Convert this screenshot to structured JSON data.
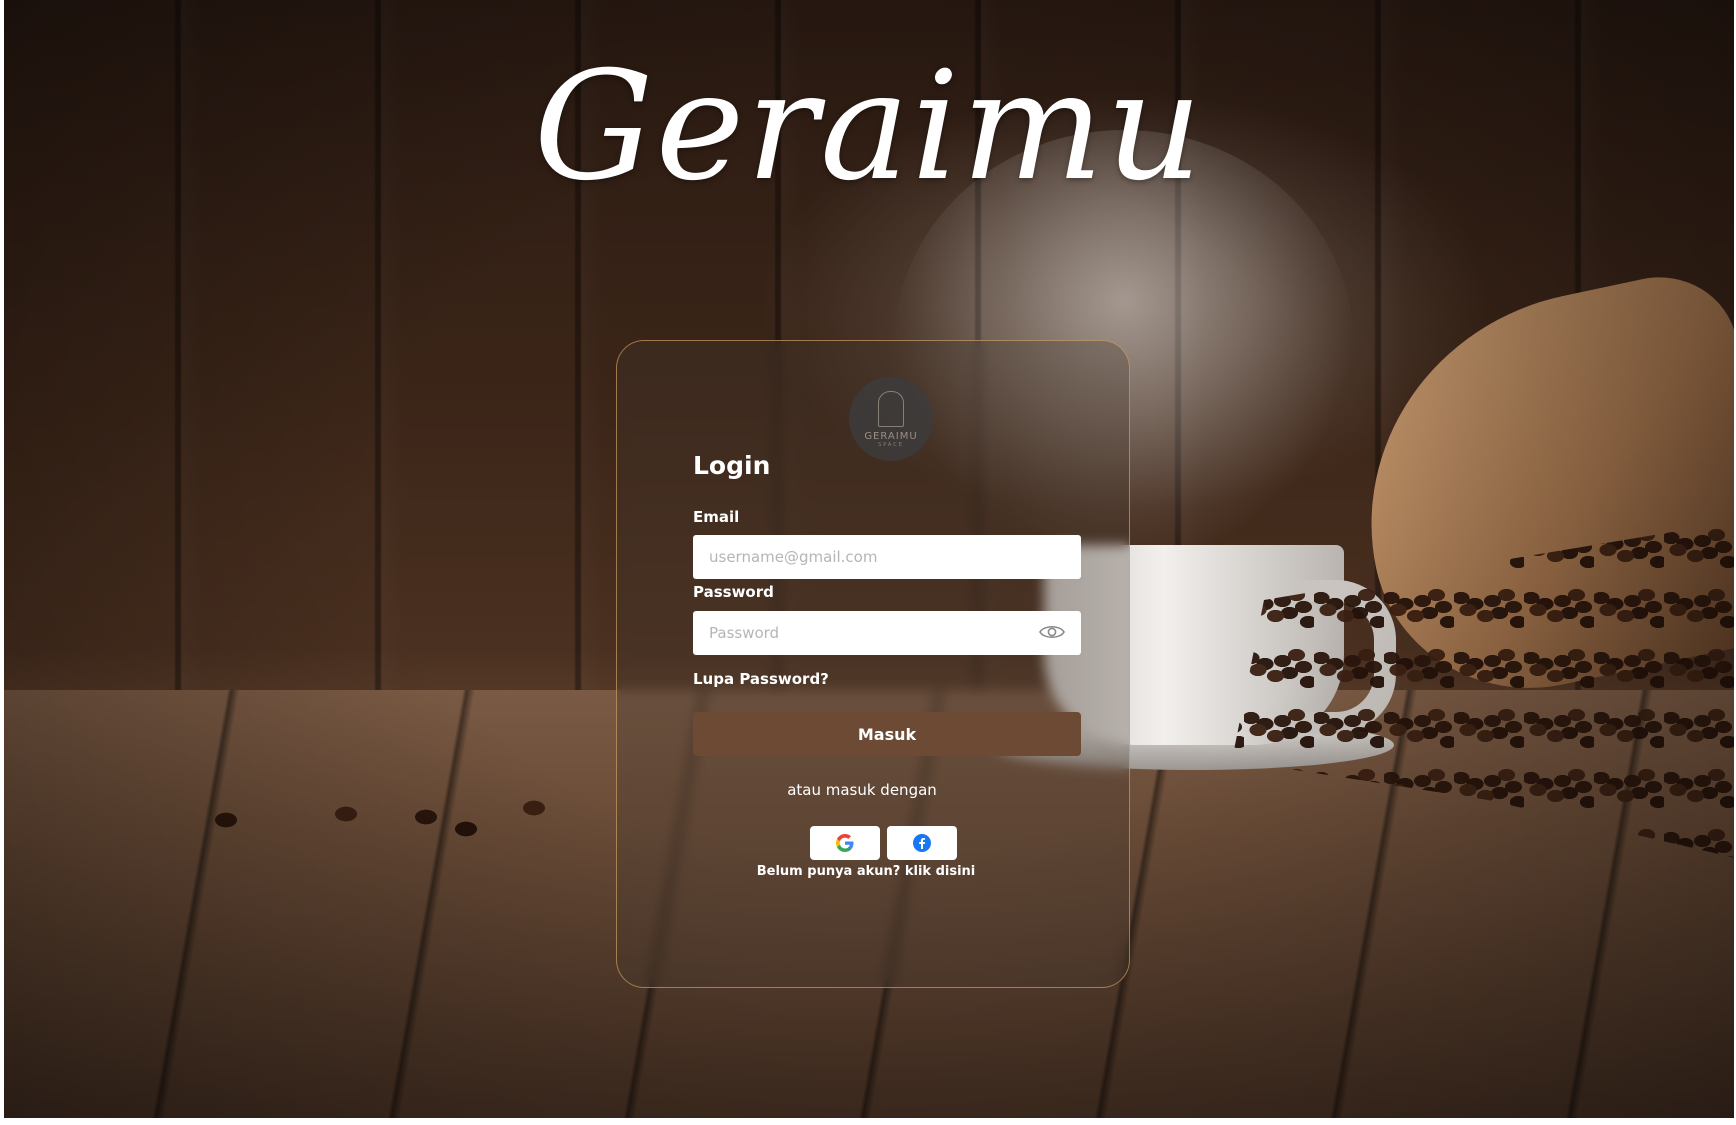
{
  "brand": {
    "name": "Geraimu"
  },
  "logo": {
    "text": "GERAIMU",
    "sub": "SPACE"
  },
  "login": {
    "title": "Login",
    "email_label": "Email",
    "email_placeholder": "username@gmail.com",
    "password_label": "Password",
    "password_placeholder": "Password",
    "forgot": "Lupa Password?",
    "submit": "Masuk",
    "alt_text": "atau masuk dengan",
    "signup": "Belum punya akun? klik disini"
  },
  "social": [
    {
      "name": "google-icon"
    },
    {
      "name": "facebook-icon"
    }
  ],
  "colors": {
    "button": "#6d4a33",
    "card_border": "#d6a864",
    "facebook": "#1877f2"
  }
}
